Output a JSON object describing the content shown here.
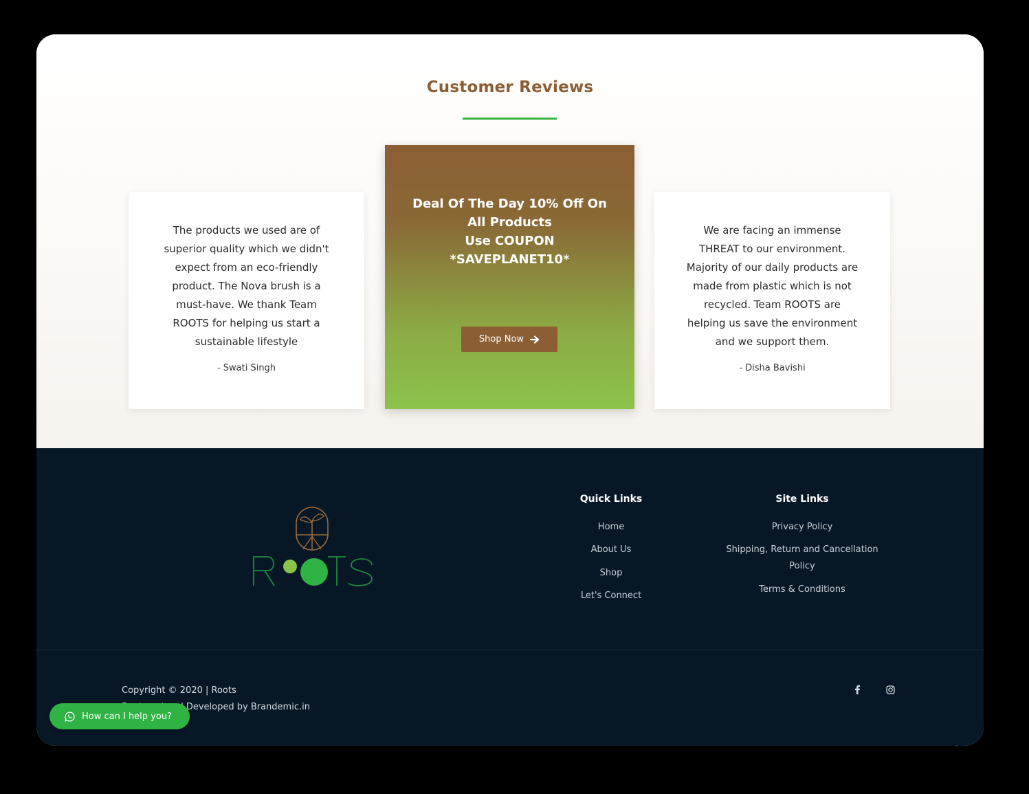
{
  "reviews": {
    "title": "Customer Reviews",
    "left_card": {
      "text": "The products we used are of superior quality which we didn't expect from an eco-friendly product. The Nova brush is a must-have. We thank Team ROOTS for helping us start a sustainable lifestyle",
      "author": "- Swati Singh"
    },
    "promo": {
      "line1": "Deal Of The Day 10% Off On",
      "line2": "All Products",
      "line3": "Use COUPON",
      "line4": "*SAVEPLANET10*",
      "button_label": "Shop Now",
      "button_icon": "arrow-right-icon"
    },
    "right_card": {
      "text": "We are facing an immense THREAT to our environment. Majority of our daily products are made from plastic which is not recycled. Team ROOTS are helping us save the environment and we support them.",
      "author": "- Disha Bavishi"
    }
  },
  "footer": {
    "logo_text": "ROOTS",
    "quick_links": {
      "heading": "Quick Links",
      "items": [
        "Home",
        "About Us",
        "Shop",
        "Let's Connect"
      ]
    },
    "site_links": {
      "heading": "Site Links",
      "items": [
        "Privacy Policy",
        "Shipping, Return and Cancellation Policy",
        "Terms & Conditions"
      ]
    },
    "copyright": {
      "line1": "Copyright © 2020 | Roots",
      "line2": "Designed and Developed by Brandemic.in"
    },
    "social_icons": [
      "facebook-icon",
      "instagram-icon"
    ],
    "scroll_icon": "arrow-up-icon"
  },
  "whatsapp": {
    "label": "How can I help you?",
    "icon": "whatsapp-icon"
  },
  "colors": {
    "title_brown": "#8b5e34",
    "accent_green": "#3cb043",
    "footer_bg": "#071726",
    "whatsapp_green": "#2fb344"
  }
}
